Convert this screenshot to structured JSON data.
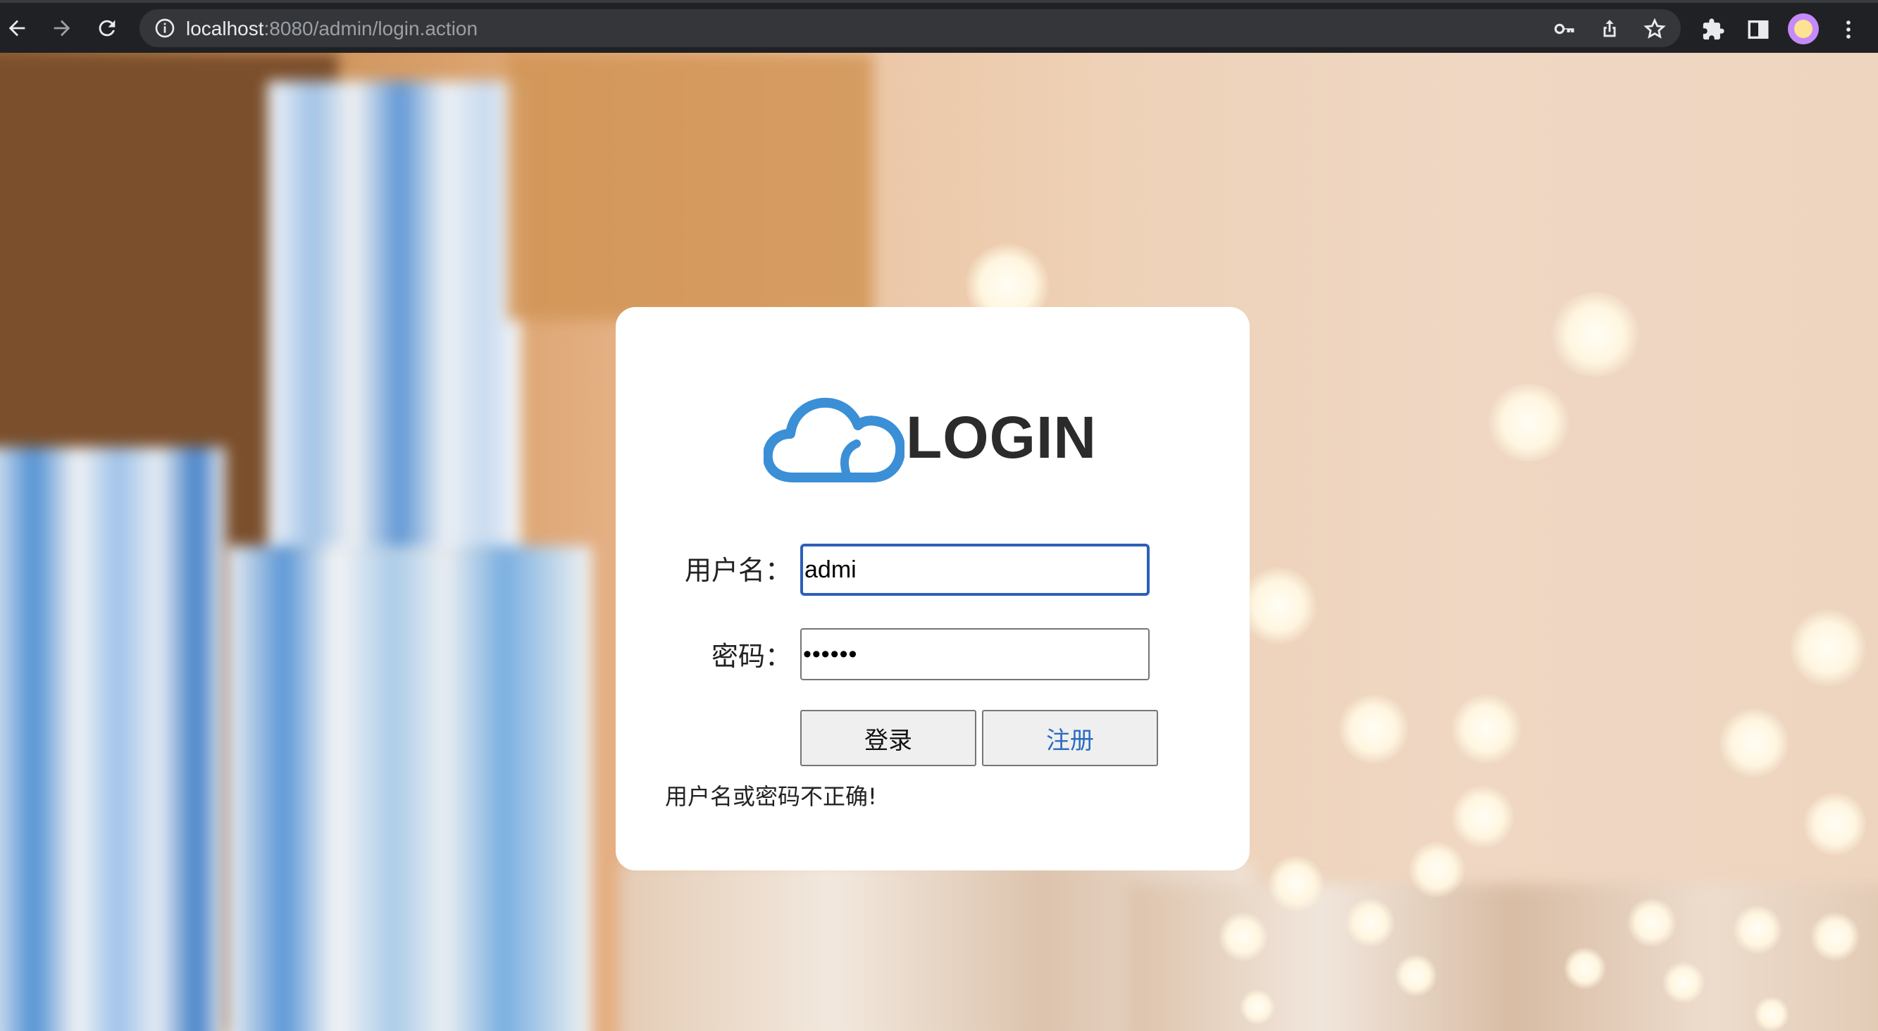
{
  "browser": {
    "url_host": "localhost",
    "url_path": ":8080/admin/login.action",
    "icons": [
      "back-arrow-icon",
      "forward-arrow-icon",
      "reload-icon",
      "info-icon",
      "key-icon",
      "share-icon",
      "star-icon",
      "extensions-icon",
      "side-panel-icon",
      "profile-avatar",
      "menu-icon"
    ]
  },
  "login": {
    "logo_text": "LOGIN",
    "username_label": "用户名：",
    "username_value": "admi",
    "password_label": "密码：",
    "password_value": "••••••",
    "login_button": "登录",
    "register_button": "注册",
    "error_message": "用户名或密码不正确!"
  },
  "colors": {
    "accent_focus": "#2d5fb8",
    "cloud_blue": "#3b8fd6",
    "register_link": "#2b6cc4"
  }
}
